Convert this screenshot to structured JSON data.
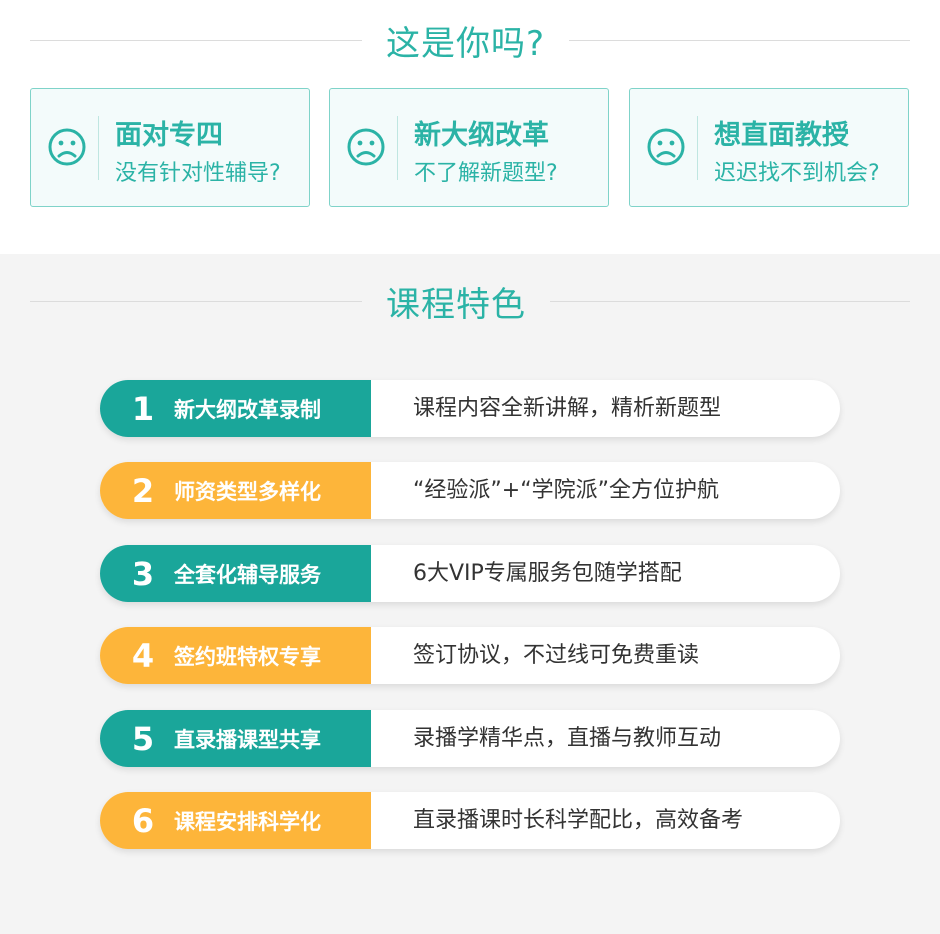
{
  "header": {
    "title": "这是你吗?"
  },
  "pain_points": [
    {
      "title": "面对专四",
      "subtitle": "没有针对性辅导?",
      "icon": "sad-face-icon"
    },
    {
      "title": "新大纲改革",
      "subtitle": "不了解新题型?",
      "icon": "sad-face-icon"
    },
    {
      "title": "想直面教授",
      "subtitle": "迟迟找不到机会?",
      "icon": "sad-face-icon"
    }
  ],
  "features_section": {
    "title": "课程特色"
  },
  "features": [
    {
      "number": "1",
      "label": "新大纲改革录制",
      "desc": "课程内容全新讲解，精析新题型",
      "color": "teal"
    },
    {
      "number": "2",
      "label": "师资类型多样化",
      "desc": "“经验派”+“学院派”全方位护航",
      "color": "amber"
    },
    {
      "number": "3",
      "label": "全套化辅导服务",
      "desc": "6大VIP专属服务包随学搭配",
      "color": "teal"
    },
    {
      "number": "4",
      "label": "签约班特权专享",
      "desc": "签订协议，不过线可免费重读",
      "color": "amber"
    },
    {
      "number": "5",
      "label": "直录播课型共享",
      "desc": "录播学精华点，直播与教师互动",
      "color": "teal"
    },
    {
      "number": "6",
      "label": "课程安排科学化",
      "desc": "直录播课时长科学配比，高效备考",
      "color": "amber"
    }
  ],
  "colors": {
    "teal": "#1aa69a",
    "amber": "#fdb53a",
    "accent_text": "#2bb3a6"
  }
}
